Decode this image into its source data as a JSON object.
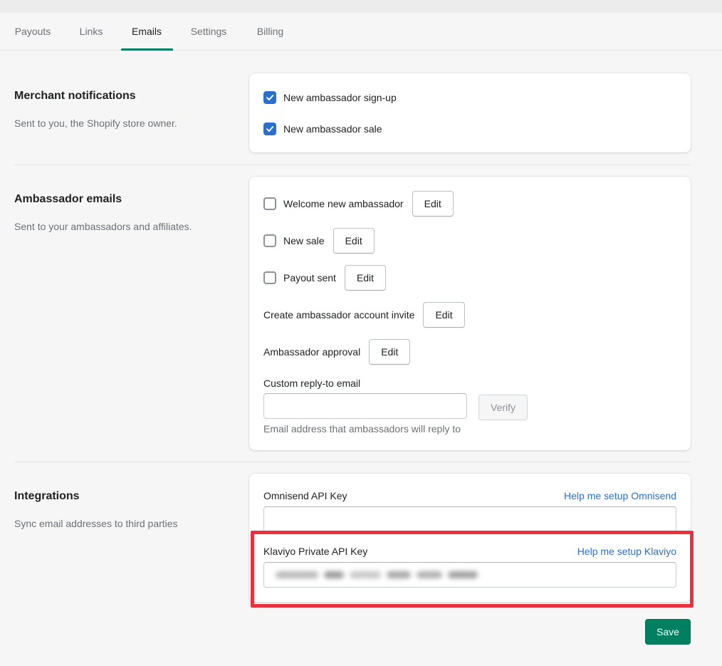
{
  "tabs": [
    {
      "label": "Payouts",
      "active": false
    },
    {
      "label": "Links",
      "active": false
    },
    {
      "label": "Emails",
      "active": true
    },
    {
      "label": "Settings",
      "active": false
    },
    {
      "label": "Billing",
      "active": false
    }
  ],
  "merchant": {
    "title": "Merchant notifications",
    "description": "Sent to you, the Shopify store owner.",
    "options": [
      {
        "label": "New ambassador sign-up",
        "checked": true
      },
      {
        "label": "New ambassador sale",
        "checked": true
      }
    ]
  },
  "ambassador": {
    "title": "Ambassador emails",
    "description": "Sent to your ambassadors and affiliates.",
    "options": [
      {
        "label": "Welcome new ambassador",
        "checked": false,
        "edit": "Edit"
      },
      {
        "label": "New sale",
        "checked": false,
        "edit": "Edit"
      },
      {
        "label": "Payout sent",
        "checked": false,
        "edit": "Edit"
      },
      {
        "label": "Create ambassador account invite",
        "edit": "Edit"
      },
      {
        "label": "Ambassador approval",
        "edit": "Edit"
      }
    ],
    "reply_to": {
      "label": "Custom reply-to email",
      "value": "",
      "verify": "Verify",
      "help": "Email address that ambassadors will reply to"
    }
  },
  "integrations": {
    "title": "Integrations",
    "description": "Sync email addresses to third parties",
    "omnisend": {
      "label": "Omnisend API Key",
      "link": "Help me setup Omnisend",
      "value": ""
    },
    "klaviyo": {
      "label": "Klaviyo Private API Key",
      "link": "Help me setup Klaviyo"
    }
  },
  "save_label": "Save",
  "colors": {
    "accent": "#008060",
    "checkbox": "#2c6ecb",
    "link": "#2c6ecb",
    "highlight": "#e8323f"
  }
}
